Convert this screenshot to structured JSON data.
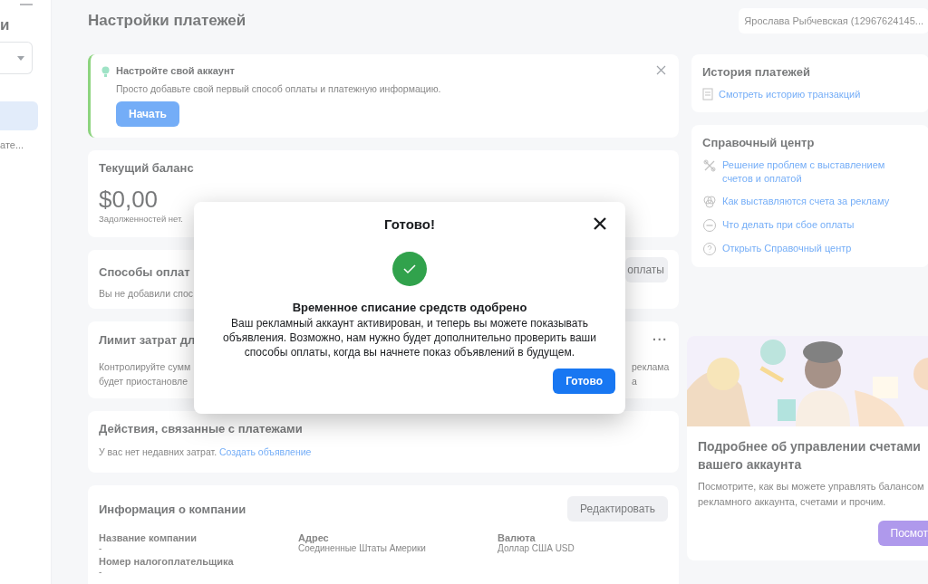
{
  "sidebar": {
    "heading": "и",
    "items": [
      {
        "selected": true
      },
      {
        "label": "ате...",
        "selected": false
      }
    ]
  },
  "header": {
    "title": "Настройки платежей",
    "account": "Ярослава Рыбчевская (12967624145..."
  },
  "setup_card": {
    "title": "Настройте свой аккаунт",
    "text": "Просто добавьте свой первый способ оплаты и платежную информацию.",
    "button": "Начать"
  },
  "balance_card": {
    "title": "Текущий баланс",
    "amount": "$0,00",
    "note": "Задолженностей нет."
  },
  "payment_methods_card": {
    "title": "Способы оплат",
    "text": "Вы не добавили спос",
    "button": "оплаты"
  },
  "spending_limit_card": {
    "title": "Лимит затрат дл",
    "menu": "···",
    "lines": [
      "Контролируйте сумм",
      "будет приостановле"
    ],
    "right_lines": [
      "реклама",
      "а"
    ]
  },
  "activity_card": {
    "title": "Действия, связанные с платежами",
    "text": "У вас нет недавних затрат.",
    "link": "Создать объявление"
  },
  "company_card": {
    "title": "Информация о компании",
    "button": "Редактировать",
    "fields": [
      {
        "label": "Название компании",
        "value": "-"
      },
      {
        "label": "Адрес",
        "value": "Соединенные Штаты Америки"
      },
      {
        "label": "Валюта",
        "value": "Доллар США USD"
      },
      {
        "label": "Номер налогоплательщика",
        "value": "-"
      }
    ]
  },
  "history_card": {
    "title": "История платежей",
    "link": "Смотреть историю транзакций"
  },
  "help_center": {
    "title": "Справочный центр",
    "links": [
      "Решение проблем с выставлением счетов и оплатой",
      "Как выставляются счета за рекламу",
      "Что делать при сбое оплаты",
      "Открыть Справочный центр"
    ]
  },
  "promo_card": {
    "title": "Подробнее об управлении счетами вашего аккаунта",
    "text": "Посмотрите, как вы можете управлять балансом рекламного аккаунта, счетами и прочим.",
    "button": "Посмот"
  },
  "dialog": {
    "title": "Готово!",
    "heading": "Временное списание средств одобрено",
    "text": "Ваш рекламный аккаунт активирован, и теперь вы можете показывать объявления. Возможно, нам нужно будет дополнительно проверить ваши способы оплаты, когда вы начнете показ объявлений в будущем.",
    "button": "Готово"
  }
}
